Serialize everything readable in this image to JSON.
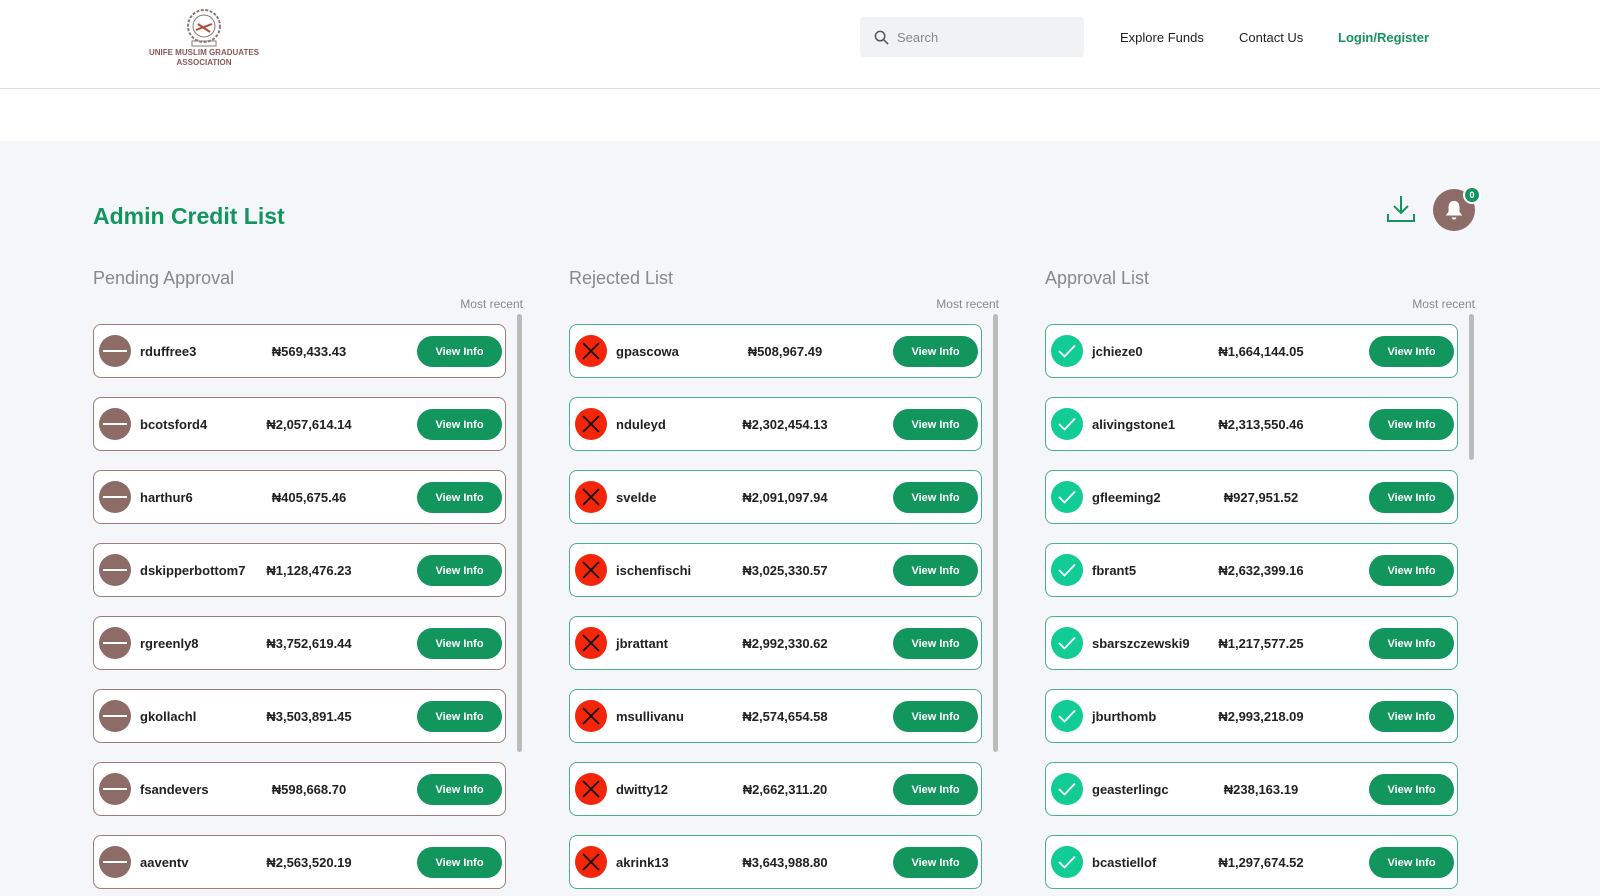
{
  "header": {
    "logo_text": "UNIFE MUSLIM GRADUATES ASSOCIATION",
    "search_placeholder": "Search",
    "nav": [
      "Explore Funds",
      "Contact Us",
      "Login/Register"
    ]
  },
  "page": {
    "title": "Admin Credit List",
    "notification_count": "0",
    "icons": [
      "download-icon",
      "bell-icon"
    ]
  },
  "colors": {
    "accent": "#13955e",
    "pending": "#8d6b67",
    "rejected": "#f3250a",
    "approved": "#12cc95"
  },
  "columns": [
    {
      "title": "Pending Approval",
      "sort": "Most recent",
      "status": "pending",
      "items": [
        {
          "user": "rduffree3",
          "amount": "₦569,433.43",
          "action": "View Info"
        },
        {
          "user": "bcotsford4",
          "amount": "₦2,057,614.14",
          "action": "View Info"
        },
        {
          "user": "harthur6",
          "amount": "₦405,675.46",
          "action": "View Info"
        },
        {
          "user": "dskipperbottom7",
          "amount": "₦1,128,476.23",
          "action": "View Info"
        },
        {
          "user": "rgreenly8",
          "amount": "₦3,752,619.44",
          "action": "View Info"
        },
        {
          "user": "gkollachl",
          "amount": "₦3,503,891.45",
          "action": "View Info"
        },
        {
          "user": "fsandevers",
          "amount": "₦598,668.70",
          "action": "View Info"
        },
        {
          "user": "aaventv",
          "amount": "₦2,563,520.19",
          "action": "View Info"
        }
      ]
    },
    {
      "title": "Rejected List",
      "sort": "Most recent",
      "status": "rejected",
      "items": [
        {
          "user": "gpascowa",
          "amount": "₦508,967.49",
          "action": "View Info"
        },
        {
          "user": "nduleyd",
          "amount": "₦2,302,454.13",
          "action": "View Info"
        },
        {
          "user": "svelde",
          "amount": "₦2,091,097.94",
          "action": "View Info"
        },
        {
          "user": "ischenfischi",
          "amount": "₦3,025,330.57",
          "action": "View Info"
        },
        {
          "user": "jbrattant",
          "amount": "₦2,992,330.62",
          "action": "View Info"
        },
        {
          "user": "msullivanu",
          "amount": "₦2,574,654.58",
          "action": "View Info"
        },
        {
          "user": "dwitty12",
          "amount": "₦2,662,311.20",
          "action": "View Info"
        },
        {
          "user": "akrink13",
          "amount": "₦3,643,988.80",
          "action": "View Info"
        }
      ]
    },
    {
      "title": "Approval List",
      "sort": "Most recent",
      "status": "approved",
      "items": [
        {
          "user": "jchieze0",
          "amount": "₦1,664,144.05",
          "action": "View Info"
        },
        {
          "user": "alivingstone1",
          "amount": "₦2,313,550.46",
          "action": "View Info"
        },
        {
          "user": "gfleeming2",
          "amount": "₦927,951.52",
          "action": "View Info"
        },
        {
          "user": "fbrant5",
          "amount": "₦2,632,399.16",
          "action": "View Info"
        },
        {
          "user": "sbarszczewski9",
          "amount": "₦1,217,577.25",
          "action": "View Info"
        },
        {
          "user": "jburthomb",
          "amount": "₦2,993,218.09",
          "action": "View Info"
        },
        {
          "user": "geasterlingc",
          "amount": "₦238,163.19",
          "action": "View Info"
        },
        {
          "user": "bcastiellof",
          "amount": "₦1,297,674.52",
          "action": "View Info"
        }
      ]
    }
  ]
}
